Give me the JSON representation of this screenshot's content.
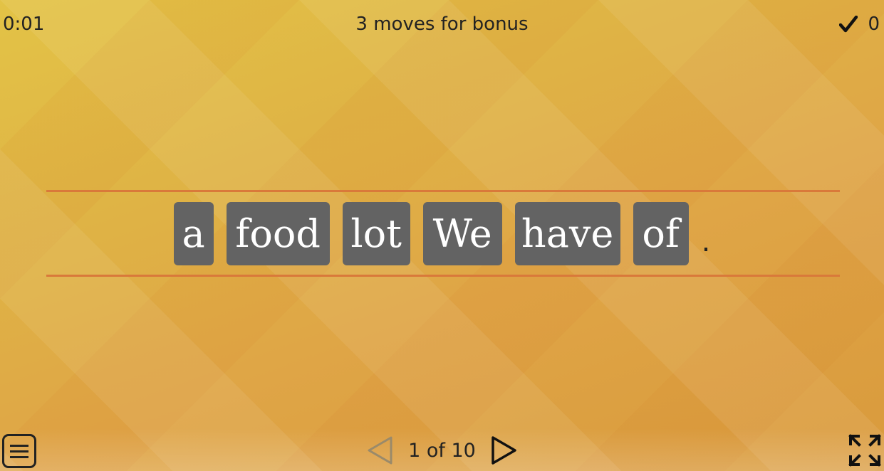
{
  "header": {
    "timer": "0:01",
    "bonus_text": "3 moves for bonus",
    "score": "0"
  },
  "sentence": {
    "tiles": [
      "a",
      "food",
      "lot",
      "We",
      "have",
      "of"
    ],
    "period": "."
  },
  "footer": {
    "page_indicator": "1 of 10"
  },
  "colors": {
    "tile": "#636363",
    "guide_line": "#d9793a"
  }
}
